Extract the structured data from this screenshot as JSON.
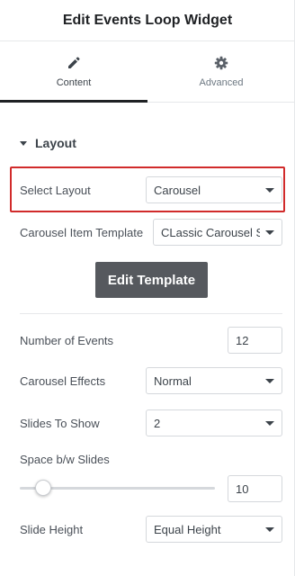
{
  "header": {
    "title": "Edit Events Loop Widget"
  },
  "tabs": [
    {
      "label": "Content",
      "icon": "pencil-icon",
      "active": true
    },
    {
      "label": "Advanced",
      "icon": "gear-icon",
      "active": false
    }
  ],
  "section": {
    "title": "Layout",
    "icon": "caret-down-icon"
  },
  "fields": {
    "select_layout": {
      "label": "Select Layout",
      "value": "Carousel"
    },
    "carousel_item_template": {
      "label": "Carousel Item Template",
      "value": "CLassic Carousel S"
    },
    "edit_template_button": {
      "label": "Edit Template"
    },
    "number_of_events": {
      "label": "Number of Events",
      "value": "12"
    },
    "carousel_effects": {
      "label": "Carousel Effects",
      "value": "Normal"
    },
    "slides_to_show": {
      "label": "Slides To Show",
      "value": "2"
    },
    "space_between_slides": {
      "label": "Space b/w Slides",
      "value": "10",
      "slider_fraction": 0.1
    },
    "slide_height": {
      "label": "Slide Height",
      "value": "Equal Height"
    }
  },
  "colors": {
    "highlight": "#d12b2b",
    "button_bg": "#56595e",
    "active_tab_underline": "#1f2124"
  }
}
